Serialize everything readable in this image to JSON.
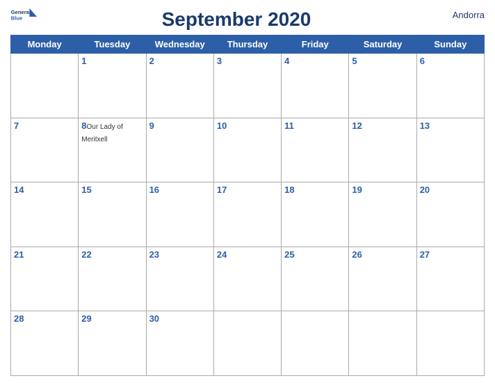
{
  "header": {
    "title": "September 2020",
    "country": "Andorra",
    "logo_general": "General",
    "logo_blue": "Blue"
  },
  "days": [
    "Monday",
    "Tuesday",
    "Wednesday",
    "Thursday",
    "Friday",
    "Saturday",
    "Sunday"
  ],
  "weeks": [
    [
      {
        "num": "",
        "event": ""
      },
      {
        "num": "1",
        "event": ""
      },
      {
        "num": "2",
        "event": ""
      },
      {
        "num": "3",
        "event": ""
      },
      {
        "num": "4",
        "event": ""
      },
      {
        "num": "5",
        "event": ""
      },
      {
        "num": "6",
        "event": ""
      }
    ],
    [
      {
        "num": "7",
        "event": ""
      },
      {
        "num": "8",
        "event": "Our Lady of\nMeritxell"
      },
      {
        "num": "9",
        "event": ""
      },
      {
        "num": "10",
        "event": ""
      },
      {
        "num": "11",
        "event": ""
      },
      {
        "num": "12",
        "event": ""
      },
      {
        "num": "13",
        "event": ""
      }
    ],
    [
      {
        "num": "14",
        "event": ""
      },
      {
        "num": "15",
        "event": ""
      },
      {
        "num": "16",
        "event": ""
      },
      {
        "num": "17",
        "event": ""
      },
      {
        "num": "18",
        "event": ""
      },
      {
        "num": "19",
        "event": ""
      },
      {
        "num": "20",
        "event": ""
      }
    ],
    [
      {
        "num": "21",
        "event": ""
      },
      {
        "num": "22",
        "event": ""
      },
      {
        "num": "23",
        "event": ""
      },
      {
        "num": "24",
        "event": ""
      },
      {
        "num": "25",
        "event": ""
      },
      {
        "num": "26",
        "event": ""
      },
      {
        "num": "27",
        "event": ""
      }
    ],
    [
      {
        "num": "28",
        "event": ""
      },
      {
        "num": "29",
        "event": ""
      },
      {
        "num": "30",
        "event": ""
      },
      {
        "num": "",
        "event": ""
      },
      {
        "num": "",
        "event": ""
      },
      {
        "num": "",
        "event": ""
      },
      {
        "num": "",
        "event": ""
      }
    ]
  ]
}
